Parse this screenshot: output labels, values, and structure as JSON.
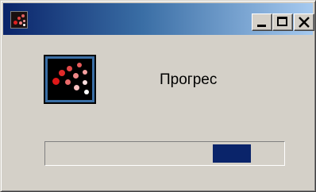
{
  "window": {
    "title": "",
    "buttons": {
      "minimize_icon": "minimize-icon",
      "maximize_icon": "maximize-icon",
      "close_icon": "close-icon"
    },
    "app_icon": "scatter-dots-icon"
  },
  "content": {
    "label": "Прогрес",
    "progress": {
      "indeterminate": true,
      "block_position_fraction": 0.7,
      "block_color": "#0a246a"
    }
  },
  "colors": {
    "face": "#d4d0c8",
    "titlebar_start": "#0a246a",
    "titlebar_end": "#a6caf0",
    "accent": "#0a246a"
  }
}
